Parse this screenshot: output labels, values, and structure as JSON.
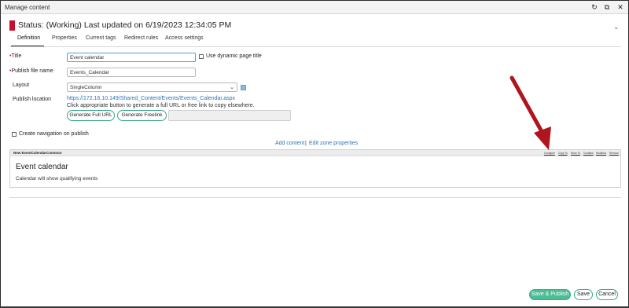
{
  "window": {
    "title": "Manage content"
  },
  "status": {
    "text": "Status: (Working) Last updated on 6/19/2023 12:34:05 PM",
    "flag_color": "#c8102e"
  },
  "tabs": [
    {
      "label": "Definition",
      "active": true
    },
    {
      "label": "Properties"
    },
    {
      "label": "Current tags"
    },
    {
      "label": "Redirect rules"
    },
    {
      "label": "Access settings"
    }
  ],
  "form": {
    "title_label": "Title",
    "title_value": "Event calendar",
    "dynamic_title_label": "Use dynamic page title",
    "publish_file_label": "Publish file name",
    "publish_file_value": "Events_Calendar",
    "layout_label": "Layout",
    "layout_value": "SingleColumn",
    "publish_location_label": "Publish location",
    "publish_location_url": "https://172.16.10.149/Shared_Content/Events/Events_Calendar.aspx",
    "publish_hint": "Click appropriate button to generate a full URL or free link to copy elsewhere.",
    "generate_full_url": "Generate Full URL",
    "generate_freelink": "Generate Freelink",
    "create_nav_label": "Create navigation on publish"
  },
  "zone_links": {
    "add_content": "Add content",
    "separator": "|",
    "edit_zone": "Edit zone properties"
  },
  "content_item": {
    "name": "New EventCalendarCommon",
    "actions": [
      "Configure",
      "Copy To",
      "Move To",
      "Contains",
      "Workflow",
      "Remove"
    ],
    "title": "Event calendar",
    "description": "Calendar will show qualifying events"
  },
  "footer": {
    "save_publish": "Save & Publish",
    "save": "Save",
    "cancel": "Cancel"
  },
  "colors": {
    "accent": "#3aa887",
    "primary_button": "#4dbd95",
    "link": "#2e74b5",
    "annotation_arrow": "#b0141c"
  },
  "icons": {
    "refresh": "refresh-icon",
    "restore": "restore-window-icon",
    "close": "close-icon",
    "collapse": "chevron-down-icon"
  }
}
